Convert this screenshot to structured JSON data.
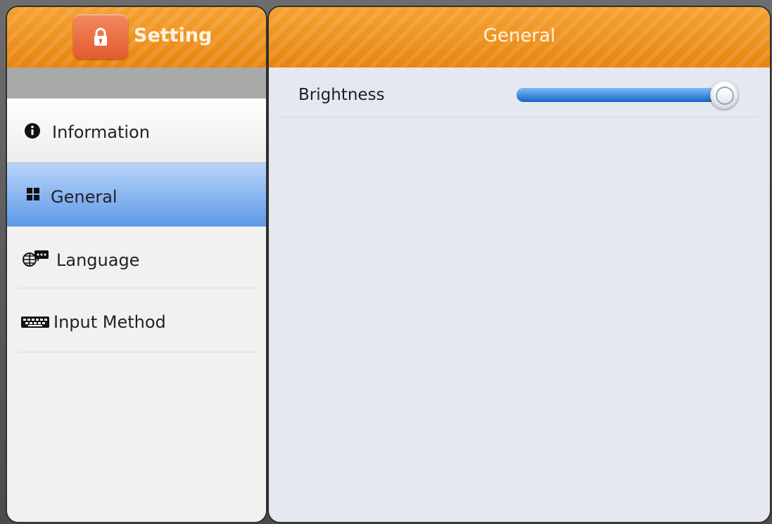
{
  "app": {
    "title": "Setting"
  },
  "sidebar": {
    "items": [
      {
        "label": "Information",
        "icon": "info-icon",
        "selected": false
      },
      {
        "label": "General",
        "icon": "grid-icon",
        "selected": true
      },
      {
        "label": "Language",
        "icon": "globe-chat-icon",
        "selected": false
      },
      {
        "label": "Input Method",
        "icon": "keyboard-icon",
        "selected": false
      }
    ]
  },
  "main": {
    "title": "General",
    "settings": [
      {
        "label": "Brightness",
        "control": "slider",
        "value": 0.95
      }
    ]
  },
  "colors": {
    "header_orange": "#ee8e1c",
    "selected_blue": "#6aa0e8",
    "slider_blue": "#2f7ed5"
  }
}
